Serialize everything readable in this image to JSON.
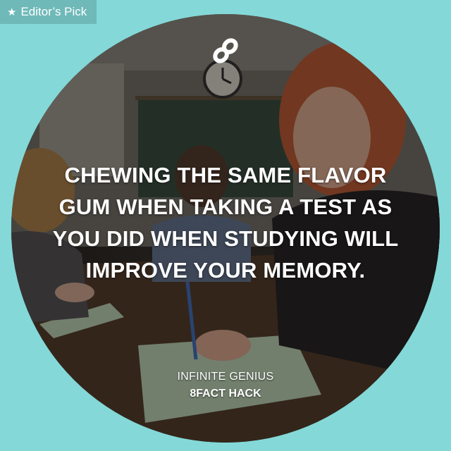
{
  "badge": {
    "icon": "star-icon",
    "label": "Editor’s Pick"
  },
  "post": {
    "logo_icon": "infinity-8-logo-icon",
    "headline": "CHEWING THE SAME FLAVOR GUM WHEN TAKING A TEST AS YOU DID WHEN STUDYING WILL IMPROVE YOUR MEMORY.",
    "footer_line1": "INFINITE GENIUS",
    "footer_line2": "8FACT HACK"
  },
  "colors": {
    "background": "#84d8d8",
    "badge_background": "#6fb9b9",
    "text": "#ffffff"
  }
}
